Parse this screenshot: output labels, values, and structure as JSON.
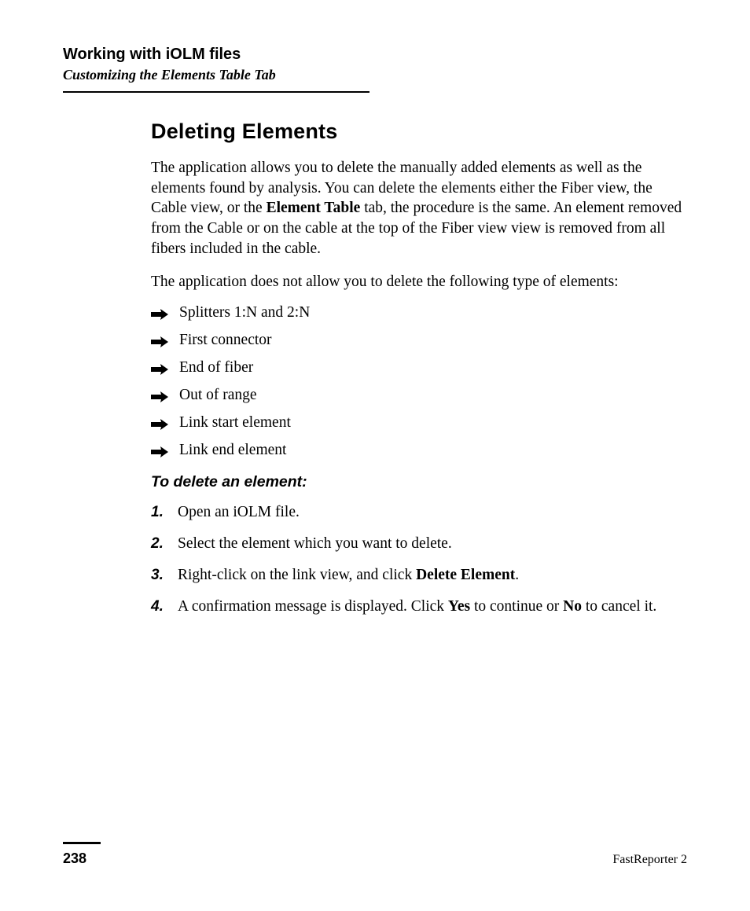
{
  "header": {
    "title": "Working with iOLM files",
    "subtitle": "Customizing the Elements Table Tab"
  },
  "section": {
    "title": "Deleting Elements",
    "para1_before": "The application allows you to delete the manually added elements as well as the elements found by analysis. You can delete the elements either the Fiber view, the Cable view, or the ",
    "para1_bold": "Element Table",
    "para1_after": " tab, the procedure is the same. An element removed from the Cable or on the cable at the top of the Fiber view view is removed from all fibers included in the cable.",
    "para2": "The application does not allow you to delete the following type of elements:",
    "bullets": [
      "Splitters 1:N and 2:N",
      "First connector",
      "End of fiber",
      "Out of range",
      "Link start element",
      "Link end element"
    ],
    "procedure_title": "To delete an element:",
    "steps": [
      {
        "num": "1.",
        "before": "Open an iOLM file."
      },
      {
        "num": "2.",
        "before": "Select the element which you want to delete."
      },
      {
        "num": "3.",
        "before": "Right-click on the link view, and click ",
        "bold1": "Delete Element",
        "after1": "."
      },
      {
        "num": "4.",
        "before": "A confirmation message is displayed. Click ",
        "bold1": "Yes",
        "mid": " to continue or ",
        "bold2": "No",
        "after2": " to cancel it."
      }
    ]
  },
  "footer": {
    "page": "238",
    "product": "FastReporter 2"
  }
}
